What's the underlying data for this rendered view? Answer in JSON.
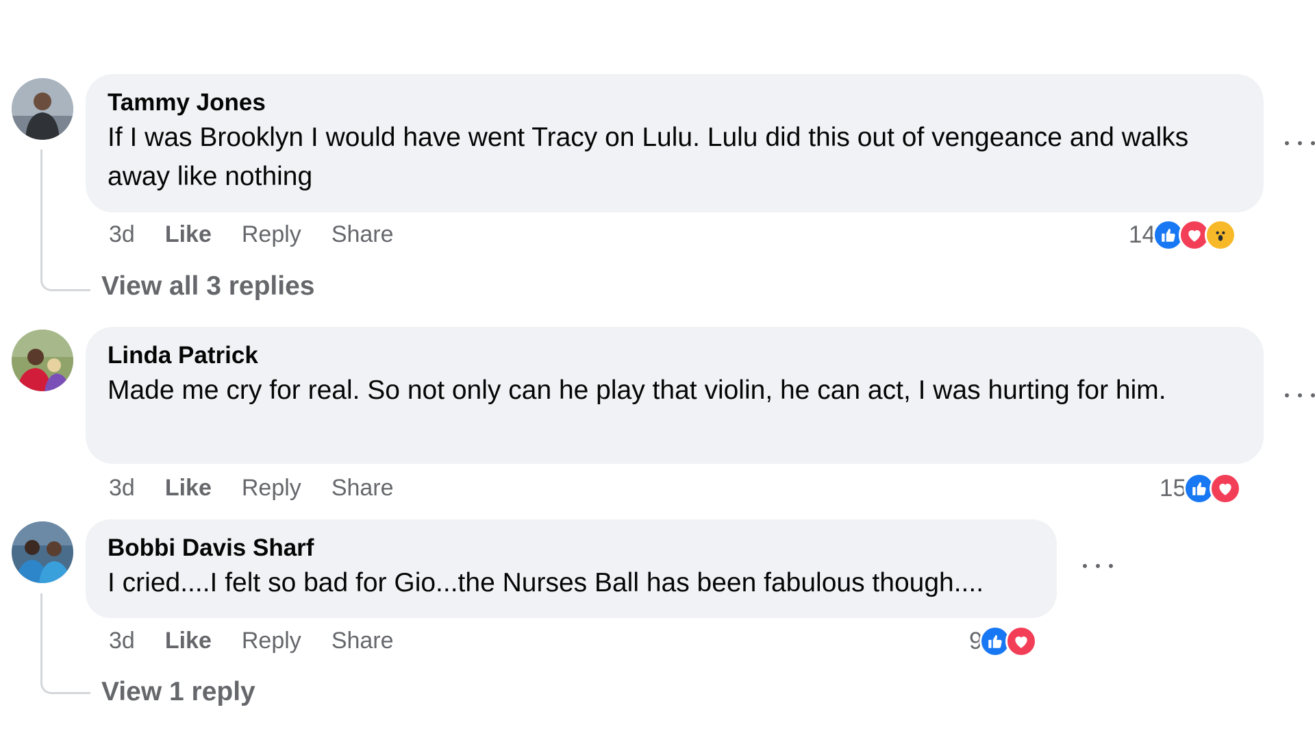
{
  "comments": [
    {
      "author": "Tammy Jones",
      "text": "If I was Brooklyn I would have went Tracy on Lulu. Lulu did this out of vengeance and walks away like nothing",
      "time": "3d",
      "like_label": "Like",
      "reply_label": "Reply",
      "share_label": "Share",
      "reaction_count": "14",
      "reactions": [
        "like-icon",
        "love-icon",
        "wow-icon"
      ],
      "view_replies": "View all 3 replies"
    },
    {
      "author": "Linda Patrick",
      "text": "Made me cry for real. So not only can he play that violin, he can act, I was hurting for him.",
      "time": "3d",
      "like_label": "Like",
      "reply_label": "Reply",
      "share_label": "Share",
      "reaction_count": "15",
      "reactions": [
        "like-icon",
        "love-icon"
      ]
    },
    {
      "author": "Bobbi Davis Sharf",
      "text": "I cried....I felt so bad for Gio...the Nurses Ball has been fabulous though....",
      "time": "3d",
      "like_label": "Like",
      "reply_label": "Reply",
      "share_label": "Share",
      "reaction_count": "9",
      "reactions": [
        "like-icon",
        "love-icon"
      ],
      "view_replies": "View 1 reply"
    }
  ],
  "colors": {
    "bubble": "#f0f2f5",
    "secondary_text": "#65676b",
    "like_blue": "#1877f2",
    "love_red": "#f33e58",
    "wow_yellow": "#f7b928"
  }
}
